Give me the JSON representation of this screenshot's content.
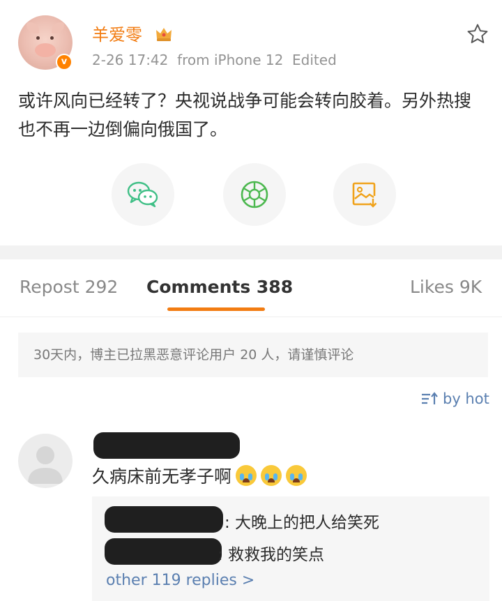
{
  "post": {
    "username": "羊爱零",
    "meta": "2-26 17:42  from iPhone 12  Edited",
    "verified_badge": "v",
    "text": "或许风向已经转了？央视说战争可能会转向胶着。另外热搜也不再一边倒偏向俄国了。",
    "share_icons": [
      "wechat-icon",
      "moments-icon",
      "save-image-icon"
    ]
  },
  "tabs": {
    "repost": "Repost 292",
    "comments": "Comments 388",
    "likes": "Likes 9K"
  },
  "notice": "30天内，博主已拉黑恶意评论用户 20 人，请谨慎评论",
  "sort_label": "by hot",
  "comment": {
    "text": "久病床前无孝子啊",
    "emoji": [
      "crying-emoji",
      "crying-emoji",
      "crying-emoji"
    ],
    "replies": [
      {
        "text": ": 大晚上的把人给笑死"
      },
      {
        "text": ": 救救我的笑点"
      }
    ],
    "more_replies": "other 119 replies >"
  },
  "colors": {
    "accent": "#f27c12",
    "link": "#5a7fb0",
    "wechat": "#3fbf86",
    "moments": "#4cb84f",
    "save": "#f0a21a"
  }
}
